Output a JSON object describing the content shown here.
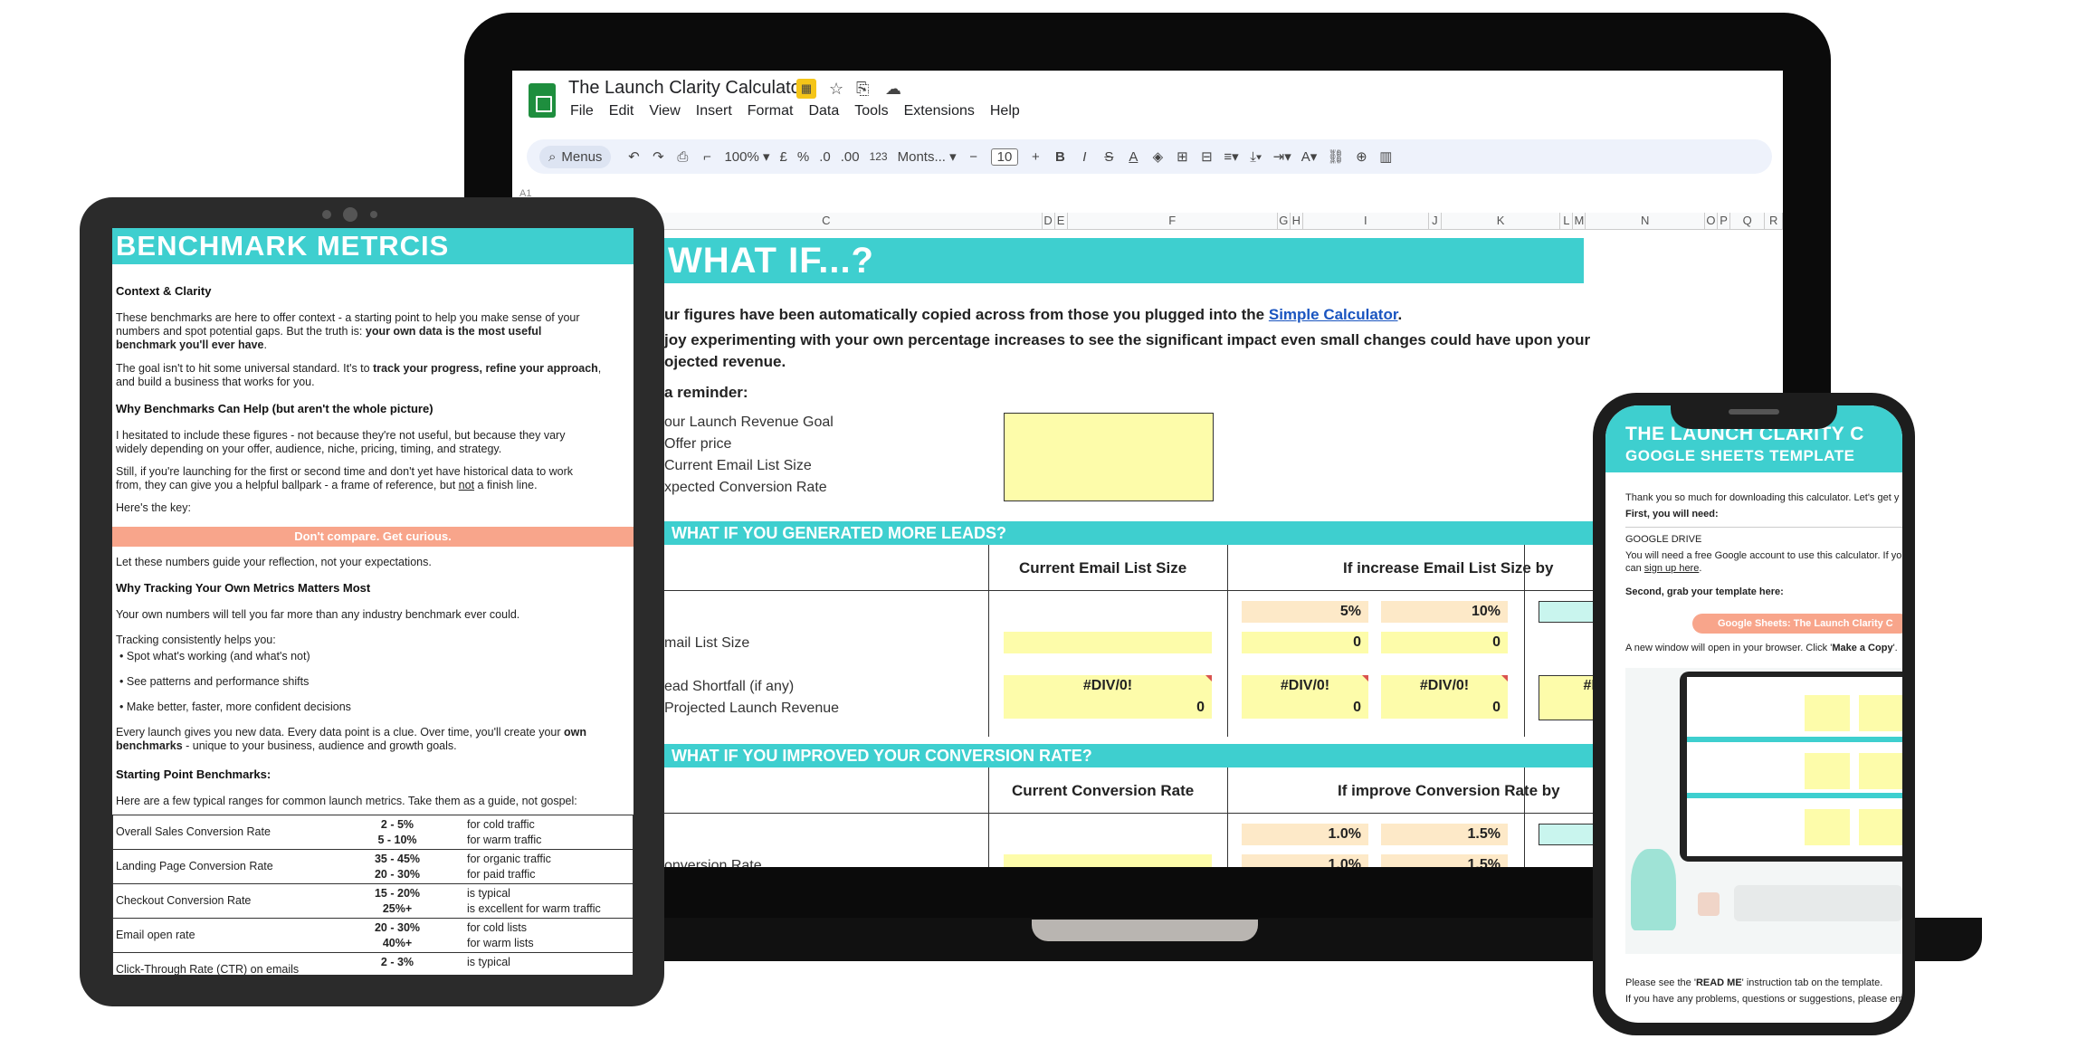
{
  "laptop": {
    "doc_title": "The Launch Clarity Calculator",
    "menu": [
      "File",
      "Edit",
      "View",
      "Insert",
      "Format",
      "Data",
      "Tools",
      "Extensions",
      "Help"
    ],
    "toolbar": {
      "menus_label": "Menus",
      "zoom": "100%",
      "currency": "£",
      "percent": "%",
      "dec_decrease": ".0",
      "dec_increase": ".00",
      "number_format": "123",
      "font": "Monts...",
      "font_size": "10",
      "bold": "B",
      "italic": "I",
      "strike": "S",
      "text_color": "A"
    },
    "cell_ref": "A1",
    "columns": [
      "C",
      "D",
      "E",
      "F",
      "G",
      "H",
      "I",
      "J",
      "K",
      "L",
      "M",
      "N",
      "O",
      "P",
      "Q",
      "R"
    ],
    "banner": "WHAT IF...?",
    "intro_line1_pre": "ur figures have been automatically copied across from those you plugged into the ",
    "intro_link": "Simple Calculator",
    "intro_line1_post": ".",
    "intro_line2": "joy experimenting with your own percentage increases to see the significant impact even small changes could have upon your",
    "intro_line3": "ojected revenue.",
    "reminder_title": "a reminder:",
    "reminder_items": [
      "our Launch Revenue Goal",
      "Offer price",
      "Current Email List Size",
      "xpected Conversion Rate"
    ],
    "leads": {
      "band": "WHAT IF YOU GENERATED MORE LEADS?",
      "col_current": "Current Email List Size",
      "col_increase": "If increase Email List Size by",
      "pct1": "5%",
      "pct2": "10%",
      "row1_label": "mail List Size",
      "row1_vals": [
        "0",
        "0"
      ],
      "row2_label": "ead Shortfall (if any)",
      "row3_label": "Projected Launch Revenue",
      "err": "#DIV/0!",
      "err_trunc": "#D",
      "rev_vals": [
        "0",
        "0",
        "0"
      ]
    },
    "conversion": {
      "band": "WHAT IF YOU IMPROVED YOUR CONVERSION RATE?",
      "col_current": "Current Conversion Rate",
      "col_increase": "If improve Conversion Rate by",
      "pct1": "1.0%",
      "pct2": "1.5%",
      "row1_label": "onversion Rate",
      "row1_vals": [
        "1.0%",
        "1.5%"
      ]
    }
  },
  "tablet": {
    "title": "BENCHMARK METRCIS",
    "h_context": "Context & Clarity",
    "p1_a": "These benchmarks are here to offer context - a starting point to help you make sense of your",
    "p1_b": "numbers and spot potential gaps. But the truth is: ",
    "p1_b_bold": "your own data is the most useful",
    "p1_c_bold": "benchmark you'll ever have",
    "p1_c": ".",
    "p2_a": "The goal isn't to hit some universal standard. It's to ",
    "p2_a_bold": "track your progress, refine your approach",
    "p2_a_end": ",",
    "p2_b": "and build a business that works for you.",
    "h_why": "Why Benchmarks Can Help (but aren't the whole picture)",
    "p3_a": "I hesitated to include these figures - not because they're not useful, but because they vary",
    "p3_b": "widely depending on your offer, audience, niche, pricing, timing, and strategy.",
    "p4_a": "Still, if you're launching for the first or second time and don't yet have historical data to work",
    "p4_b": "from, they can give you a helpful ballpark - a frame of reference, but ",
    "p4_not": "not",
    "p4_c": " a finish line.",
    "p5": "Here's the key:",
    "salmon_bar": "Don't compare. Get curious.",
    "p6": "Let these numbers guide your reflection, not your expectations.",
    "h_tracking": "Why Tracking Your Own Metrics Matters Most",
    "p7": "Your own numbers will tell you far more than any industry benchmark ever could.",
    "p8": "Tracking consistently helps you:",
    "bullets": [
      "Spot what's working (and what's not)",
      "See patterns and performance shifts",
      "Make better, faster, more confident decisions"
    ],
    "p9_a": "Every launch gives you new data. Every data point is a clue. Over time, you'll create your ",
    "p9_a_bold": "own",
    "p9_b_bold": "benchmarks",
    "p9_b": " - unique to your business, audience and growth goals.",
    "h_start": "Starting Point Benchmarks:",
    "p10": "Here are a few typical ranges for common launch metrics. Take them as a guide, not gospel:",
    "rows": [
      {
        "metric": "Overall Sales Conversion Rate",
        "r1": "2 - 5%",
        "n1": "for cold traffic",
        "r2": "5 - 10%",
        "n2": "for warm traffic"
      },
      {
        "metric": "Landing Page Conversion Rate",
        "r1": "35 - 45%",
        "n1": "for organic traffic",
        "r2": "20 - 30%",
        "n2": "for paid traffic"
      },
      {
        "metric": "Checkout Conversion Rate",
        "r1": "15 - 20%",
        "n1": "is typical",
        "r2": "25%+",
        "n2": "is excellent for warm traffic"
      },
      {
        "metric": "Email open rate",
        "r1": "20 - 30%",
        "n1": "for cold lists",
        "r2": "40%+",
        "n2": "for warm lists"
      },
      {
        "metric": "Click-Through Rate (CTR) on emails",
        "r1": "2 - 3%",
        "n1": "is typical",
        "r2": "",
        "n2": ""
      }
    ]
  },
  "phone": {
    "title1": "THE LAUNCH CLARITY C",
    "title2": "GOOGLE SHEETS TEMPLATE",
    "p1": "Thank you so much for downloading this calculator. Let's get y",
    "first": "First, you will need:",
    "gdrive": "GOOGLE DRIVE",
    "p2a": "You will need a free Google account to use this calculator. If yo",
    "p2b_pre": "can ",
    "p2b_link": "sign up here",
    "p2b_post": ".",
    "second": "Second, grab your template here:",
    "button": "Google Sheets: The Launch Clarity C",
    "p3_pre": "A new window will open in your browser. Click '",
    "p3_bold": "Make a Copy",
    "p3_post": "'.",
    "p4_pre": "Please see the '",
    "p4_bold": "READ ME",
    "p4_post": "' instruction tab on the template.",
    "p5": "If you have any problems, questions or suggestions, please em"
  },
  "colors": {
    "teal": "#3ecfcf",
    "salmon": "#f8a58b",
    "yellow": "#fdfcaa",
    "peach": "#fde9c8"
  }
}
